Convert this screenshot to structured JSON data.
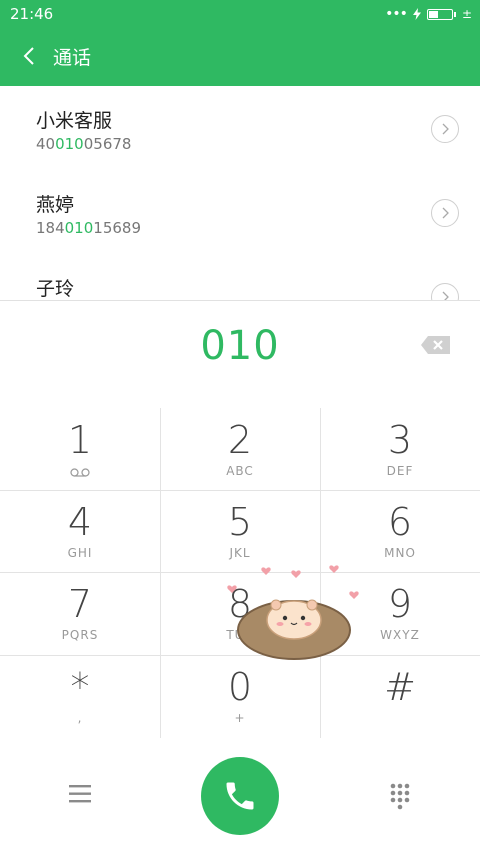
{
  "status_bar": {
    "time": "21:46",
    "signal_dots": "•••",
    "charging_mark": "±"
  },
  "header": {
    "title": "通话"
  },
  "contacts": [
    {
      "name": "小米客服",
      "number_pre": "40",
      "number_hl": "010",
      "number_post": "05678"
    },
    {
      "name": "燕婷",
      "number_pre": "184",
      "number_hl": "010",
      "number_post": "15689"
    },
    {
      "name": "子玲",
      "number_pre": "",
      "number_hl": "",
      "number_post": ""
    }
  ],
  "dial_display": {
    "digits": "010"
  },
  "keypad": [
    {
      "digit": "1",
      "letters": ""
    },
    {
      "digit": "2",
      "letters": "ABC"
    },
    {
      "digit": "3",
      "letters": "DEF"
    },
    {
      "digit": "4",
      "letters": "GHI"
    },
    {
      "digit": "5",
      "letters": "JKL"
    },
    {
      "digit": "6",
      "letters": "MNO"
    },
    {
      "digit": "7",
      "letters": "PQRS"
    },
    {
      "digit": "8",
      "letters": "TUV"
    },
    {
      "digit": "9",
      "letters": "WXYZ"
    },
    {
      "digit": "*",
      "letters": ","
    },
    {
      "digit": "0",
      "letters": "+"
    },
    {
      "digit": "#",
      "letters": ""
    }
  ],
  "icons": {
    "back": "chevron-left-icon",
    "contact_arrow": "chevron-right-icon",
    "delete": "backspace-icon",
    "voicemail": "voicemail-icon",
    "menu": "menu-icon",
    "call": "phone-icon",
    "dialpad": "dialpad-icon"
  },
  "colors": {
    "accent": "#2fb962",
    "text": "#222222",
    "secondary": "#777777",
    "divider": "#e3e3e3"
  }
}
